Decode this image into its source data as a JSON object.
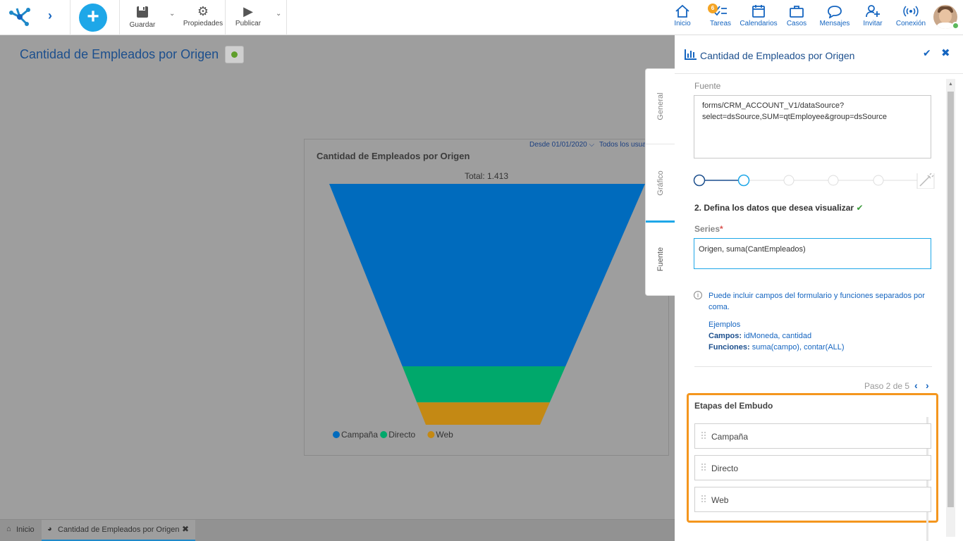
{
  "toolbar": {
    "save_label": "Guardar",
    "properties_label": "Propiedades",
    "publish_label": "Publicar"
  },
  "nav": {
    "home": "Inicio",
    "tasks": "Tareas",
    "tasks_badge": "6",
    "calendars": "Calendarios",
    "cases": "Casos",
    "messages": "Mensajes",
    "invite": "Invitar",
    "connection": "Conexión"
  },
  "page": {
    "title": "Cantidad de Empleados por Origen"
  },
  "chart_data": {
    "type": "funnel",
    "title": "Cantidad de Empleados por Origen",
    "filter_date": "Desde 01/01/2020",
    "filter_users": "Todos los usua",
    "total_label": "Total: 1.413",
    "categories": [
      "Campaña",
      "Directo",
      "Web"
    ],
    "values": [
      1070,
      212,
      131
    ],
    "colors": [
      "#006bbd",
      "#00a86b",
      "#c48914"
    ],
    "legend_position": "bottom-left"
  },
  "side_tabs": {
    "general": "General",
    "grafico": "Gráfico",
    "fuente": "Fuente"
  },
  "panel": {
    "title": "Cantidad de Empleados por Origen",
    "source_label": "Fuente",
    "source_value": "forms/CRM_ACCOUNT_V1/dataSource?select=dsSource,SUM=qtEmployee&group=dsSource",
    "step_title": "2. Defina los datos que desea visualizar",
    "series_label": "Series",
    "series_value": "Origen, suma(CantEmpleados)",
    "info_text": "Puede incluir campos del formulario y funciones separados por coma.",
    "examples_title": "Ejemplos",
    "fields_label": "Campos:",
    "fields_value": " idMoneda, cantidad",
    "functions_label": "Funciones:",
    "functions_value": " suma(campo), contar(ALL)",
    "paso": "Paso 2 de 5",
    "etapas_title": "Etapas del Embudo",
    "etapas": [
      "Campaña",
      "Directo",
      "Web"
    ]
  },
  "bottom_tabs": {
    "home": "Inicio",
    "current": "Cantidad de Empleados por Origen"
  }
}
